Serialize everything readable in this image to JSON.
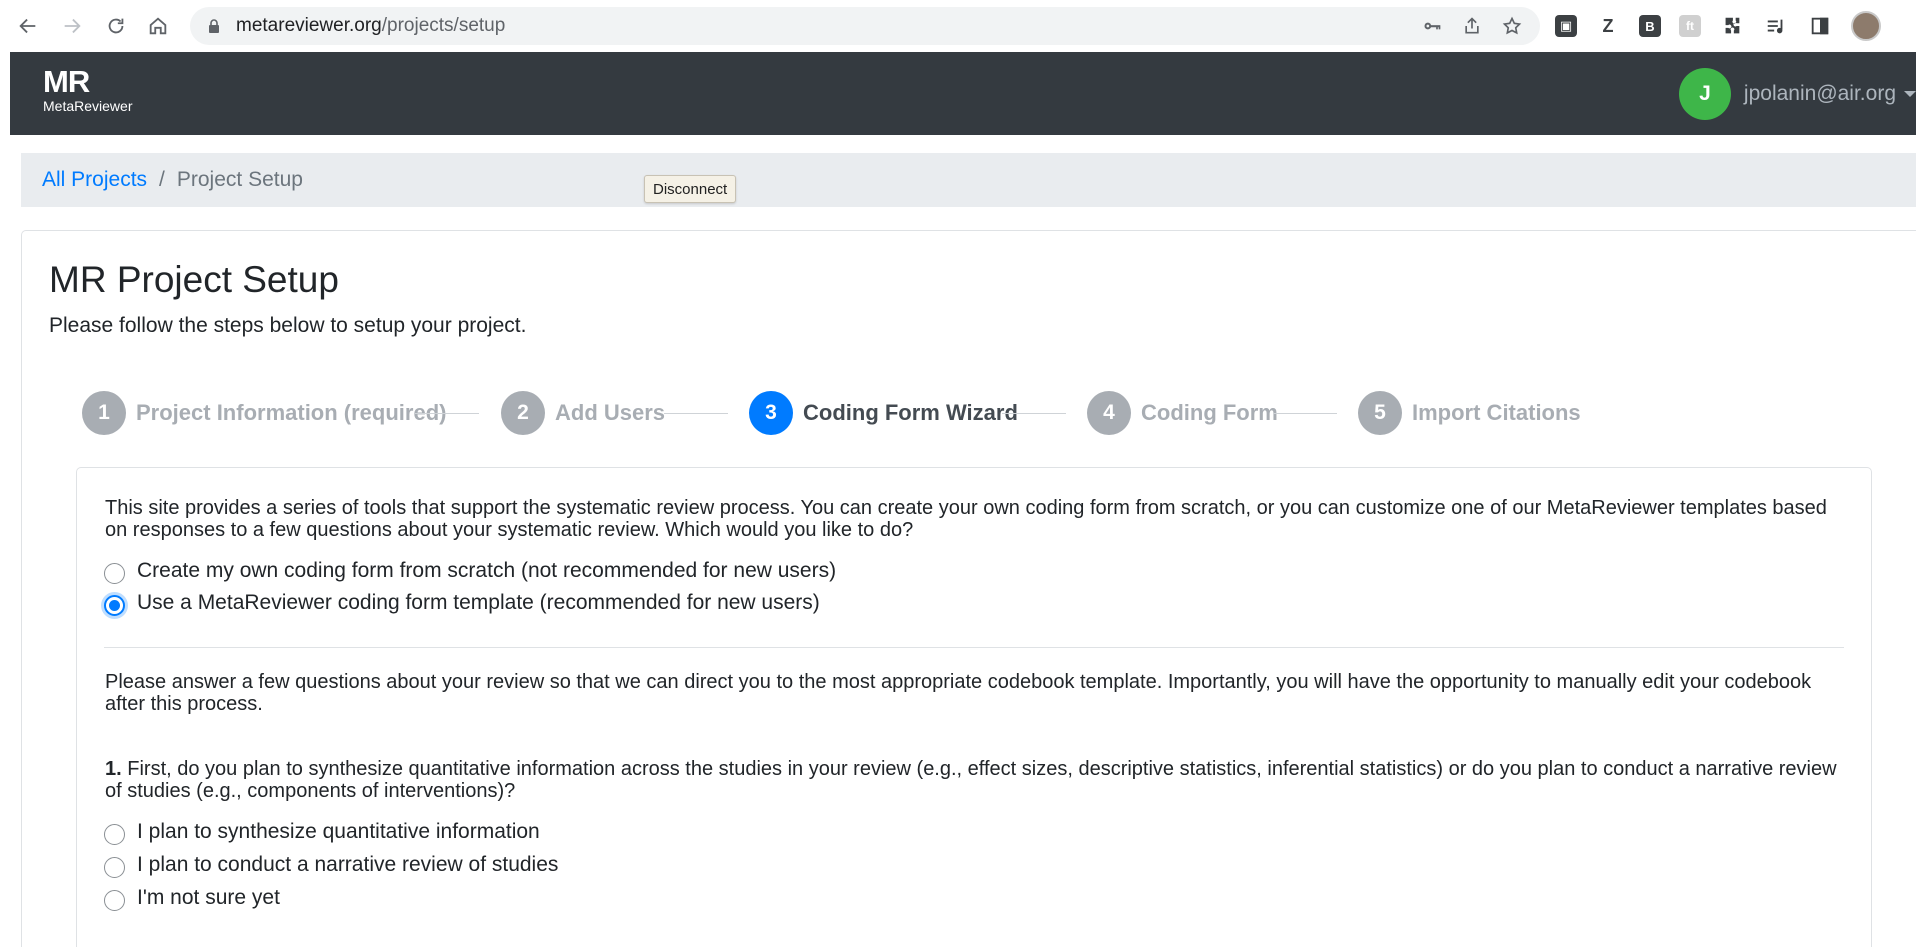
{
  "browser": {
    "url_domain": "metareviewer.org",
    "url_path": "/projects/setup",
    "extensions": [
      "key-icon",
      "share-icon",
      "star-icon",
      "ext-square",
      "Z",
      "B",
      "ext-faded",
      "puzzle-icon",
      "playlist-icon",
      "sidepanel-icon",
      "profile-avatar"
    ]
  },
  "navbar": {
    "brand_mark": "MR",
    "brand_name": "MetaReviewer",
    "user_initial": "J",
    "user_email": "jpolanin@air.org",
    "accent_color": "#3eb649"
  },
  "breadcrumb": {
    "link": "All Projects",
    "separator": "/",
    "current": "Project Setup"
  },
  "tooltip": {
    "text": "Disconnect"
  },
  "page": {
    "title": "MR Project Setup",
    "subtitle": "Please follow the steps below to setup your project."
  },
  "steps": [
    {
      "num": "1",
      "label": "Project Information (required)",
      "active": false
    },
    {
      "num": "2",
      "label": "Add Users",
      "active": false
    },
    {
      "num": "3",
      "label": "Coding Form Wizard",
      "active": true
    },
    {
      "num": "4",
      "label": "Coding Form",
      "active": false
    },
    {
      "num": "5",
      "label": "Import Citations",
      "active": false
    }
  ],
  "wizard": {
    "intro": "This site provides a series of tools that support the systematic review process. You can create your own coding form from scratch, or you can customize one of our MetaReviewer templates based on responses to a few questions about your systematic review. Which would you like to do?",
    "options": [
      {
        "label": "Create my own coding form from scratch (not recommended for new users)",
        "checked": false
      },
      {
        "label": "Use a MetaReviewer coding form template (recommended for new users)",
        "checked": true
      }
    ],
    "instructions": "Please answer a few questions about your review so that we can direct you to the most appropriate codebook template. Importantly, you will have the opportunity to manually edit your codebook after this process.",
    "question_number": "1.",
    "question_text": "First, do you plan to synthesize quantitative information across the studies in your review (e.g., effect sizes, descriptive statistics, inferential statistics) or do you plan to conduct a narrative review of studies (e.g., components of interventions)?",
    "answers": [
      {
        "label": "I plan to synthesize quantitative information",
        "checked": false
      },
      {
        "label": "I plan to conduct a narrative review of studies",
        "checked": false
      },
      {
        "label": "I'm not sure yet",
        "checked": false
      }
    ]
  }
}
